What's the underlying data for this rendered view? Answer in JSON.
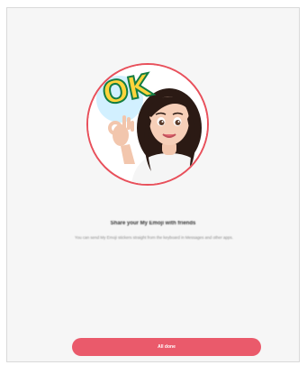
{
  "screen": {
    "sticker_text": "OK",
    "title": "Share your My Emoji with friends",
    "subtitle": "You can send My Emoji stickers straight from the keyboard in Messages and other apps.",
    "button_label": "All done"
  },
  "colors": {
    "ring": "#e8505b",
    "button": "#ea5a6b",
    "background": "#f6f6f6"
  },
  "icons": {
    "avatar": "ar-emoji-avatar"
  }
}
